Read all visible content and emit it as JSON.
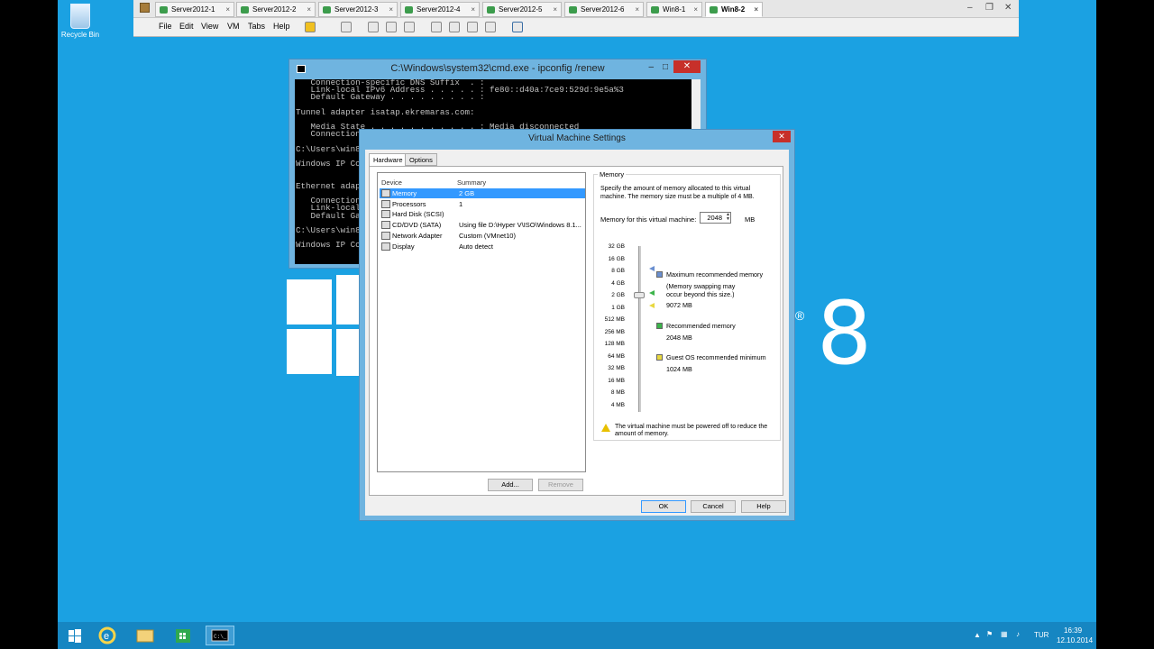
{
  "desktop": {
    "recycle_bin_label": "Recycle Bin",
    "brand_number": "8",
    "brand_reg": "®"
  },
  "vmware": {
    "tabs": [
      {
        "label": "Server2012-1",
        "active": false
      },
      {
        "label": "Server2012-2",
        "active": false
      },
      {
        "label": "Server2012-3",
        "active": false
      },
      {
        "label": "Server2012-4",
        "active": false
      },
      {
        "label": "Server2012-5",
        "active": false
      },
      {
        "label": "Server2012-6",
        "active": false
      },
      {
        "label": "Win8-1",
        "active": false
      },
      {
        "label": "Win8-2",
        "active": true
      }
    ],
    "tab_close": "×",
    "window_controls": {
      "minimize": "–",
      "restore": "❐",
      "close": "✕"
    },
    "menu": [
      "File",
      "Edit",
      "View",
      "VM",
      "Tabs",
      "Help"
    ]
  },
  "cmd": {
    "title": "C:\\Windows\\system32\\cmd.exe - ipconfig  /renew",
    "controls": {
      "minimize": "–",
      "maximize": "□",
      "close": "✕"
    },
    "lines": [
      "   Connection-specific DNS Suffix  . :",
      "   Link-local IPv6 Address . . . . . : fe80::d40a:7ce9:529d:9e5a%3",
      "   Default Gateway . . . . . . . . . :",
      "",
      "Tunnel adapter isatap.ekremaras.com:",
      "",
      "   Media State . . . . . . . . . . . : Media disconnected",
      "   Connection",
      "",
      "C:\\Users\\win8",
      "",
      "Windows IP Co",
      "",
      "",
      "Ethernet adap",
      "",
      "   Connection",
      "   Link-local",
      "   Default Ga",
      "",
      "C:\\Users\\win8",
      "",
      "Windows IP Co"
    ]
  },
  "dialog": {
    "title": "Virtual Machine Settings",
    "close": "✕",
    "tabs": [
      {
        "label": "Hardware",
        "active": true
      },
      {
        "label": "Options",
        "active": false
      }
    ],
    "device_header": "Device",
    "summary_header": "Summary",
    "devices": [
      {
        "name": "Memory",
        "summary": "2 GB",
        "selected": true,
        "icon": "memory-icon"
      },
      {
        "name": "Processors",
        "summary": "1",
        "selected": false,
        "icon": "processor-icon"
      },
      {
        "name": "Hard Disk (SCSI)",
        "summary": "",
        "selected": false,
        "icon": "hard-disk-icon"
      },
      {
        "name": "CD/DVD (SATA)",
        "summary": "Using file D:\\Hyper V\\ISO\\Windows 8.1...",
        "selected": false,
        "icon": "cd-dvd-icon"
      },
      {
        "name": "Network Adapter",
        "summary": "Custom (VMnet10)",
        "selected": false,
        "icon": "network-adapter-icon"
      },
      {
        "name": "Display",
        "summary": "Auto detect",
        "selected": false,
        "icon": "display-icon"
      }
    ],
    "add_button": "Add...",
    "remove_button": "Remove",
    "memory": {
      "group_title": "Memory",
      "description": "Specify the amount of memory allocated to this virtual machine. The memory size must be a multiple of 4 MB.",
      "field_label": "Memory for this virtual machine:",
      "value": "2048",
      "unit": "MB",
      "scale": [
        "32 GB",
        "16 GB",
        "8 GB",
        "4 GB",
        "2 GB",
        "1 GB",
        "512 MB",
        "256 MB",
        "128 MB",
        "64 MB",
        "32 MB",
        "16 MB",
        "8 MB",
        "4 MB"
      ],
      "legend": {
        "max_label": "Maximum recommended memory",
        "max_note": "(Memory swapping may occur beyond this size.)",
        "max_value": "9072 MB",
        "rec_label": "Recommended memory",
        "rec_value": "2048 MB",
        "min_label": "Guest OS recommended minimum",
        "min_value": "1024 MB"
      },
      "warning": "The virtual machine must be powered off to reduce the amount of memory."
    },
    "ok_button": "OK",
    "cancel_button": "Cancel",
    "help_button": "Help"
  },
  "taskbar": {
    "language": "TUR",
    "time": "16:39",
    "date": "12.10.2014"
  },
  "colors": {
    "desktop": "#1ba1e2",
    "taskbar": "#1686c2",
    "selection": "#3399ff",
    "close_button": "#c7302a",
    "max_marker": "#6a8fd0",
    "rec_marker": "#3cb44b",
    "min_marker": "#e8d840"
  }
}
